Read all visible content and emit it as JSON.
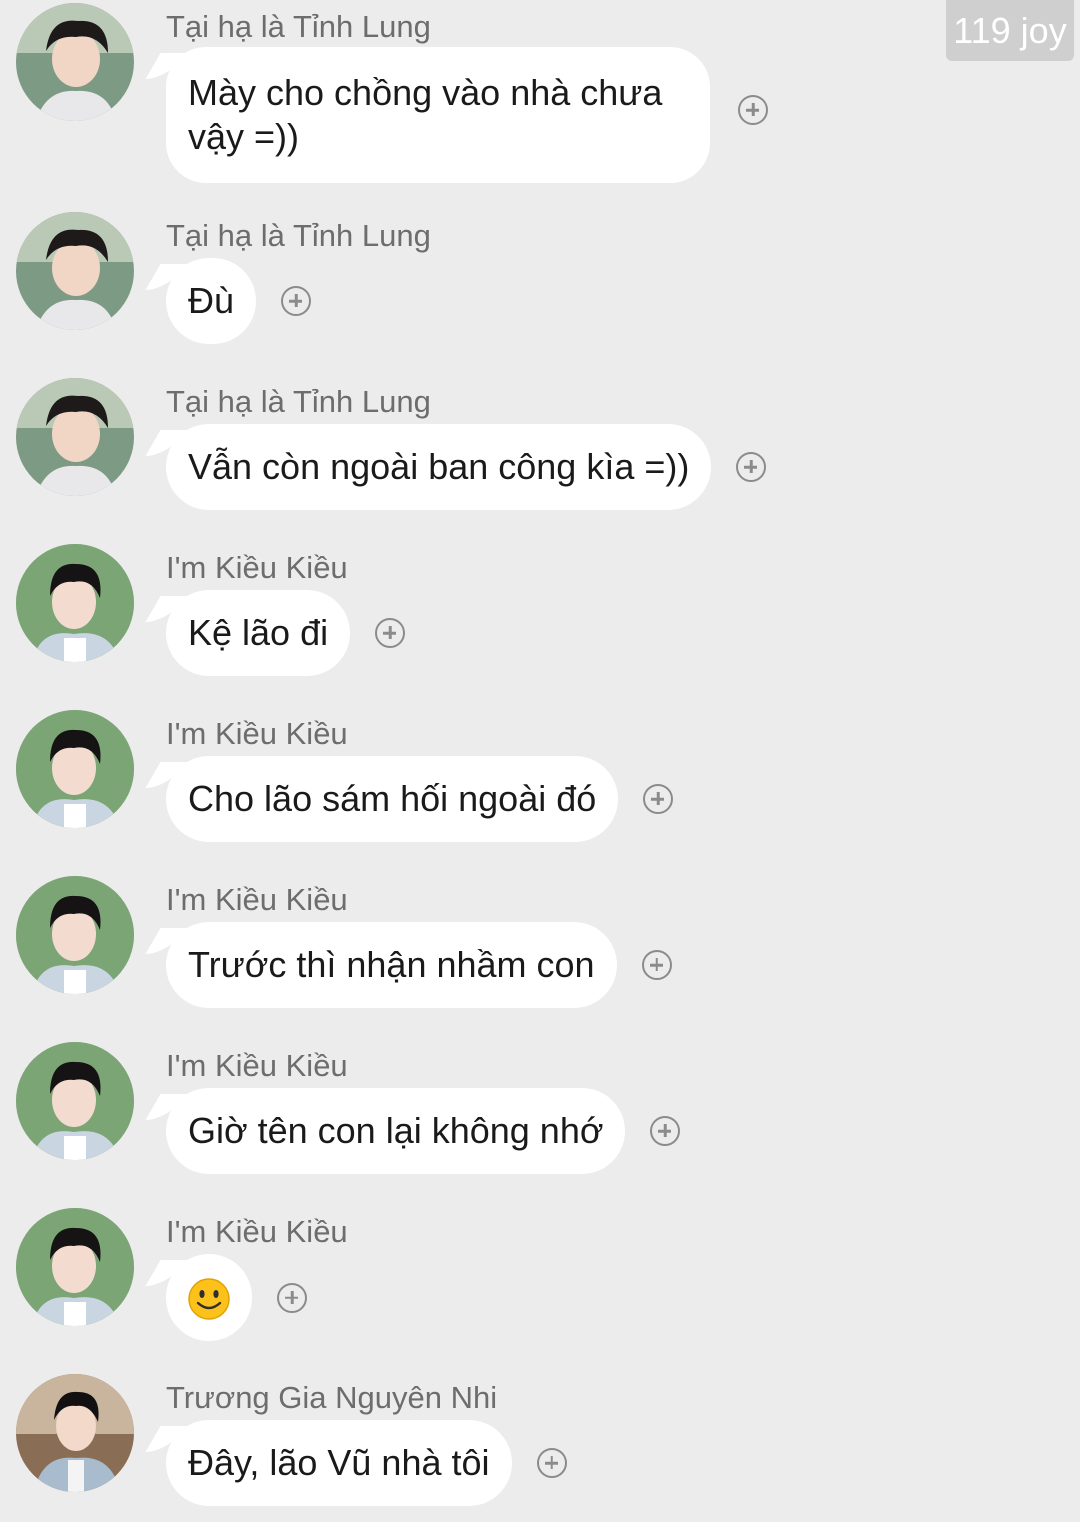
{
  "counter": "119 joy",
  "messages": [
    {
      "sender": "Tại hạ là Tỉnh Lung",
      "text": "Mày cho chồng vào nhà chưa vậy =))",
      "avatar": "avatar-a"
    },
    {
      "sender": "Tại hạ là Tỉnh Lung",
      "text": "Đù",
      "avatar": "avatar-a"
    },
    {
      "sender": "Tại hạ là Tỉnh Lung",
      "text": "Vẫn còn ngoài ban công kìa =))",
      "avatar": "avatar-a"
    },
    {
      "sender": "I'm Kiều Kiều",
      "text": "Kệ lão đi",
      "avatar": "avatar-b"
    },
    {
      "sender": "I'm Kiều Kiều",
      "text": "Cho lão sám hối ngoài đó",
      "avatar": "avatar-b"
    },
    {
      "sender": "I'm Kiều Kiều",
      "text": "Trước thì nhận nhầm con",
      "avatar": "avatar-b"
    },
    {
      "sender": "I'm Kiều Kiều",
      "text": "Giờ tên con lại không nhớ",
      "avatar": "avatar-b"
    },
    {
      "sender": "I'm Kiều Kiều",
      "text": "",
      "emoji": "smiley-face",
      "avatar": "avatar-b"
    },
    {
      "sender": "Trương Gia Nguyên Nhi",
      "text": "Đây, lão Vũ nhà tôi",
      "avatar": "avatar-c"
    }
  ],
  "icons": {
    "reaction": "add-reaction-icon"
  },
  "colors": {
    "background": "#ececec",
    "bubble": "#ffffff",
    "sender": "#6d6d6d",
    "counter_bg": "#cfcfcf"
  }
}
